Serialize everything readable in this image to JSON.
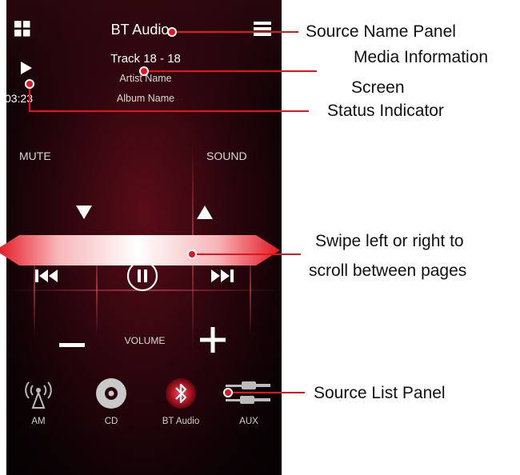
{
  "header": {
    "source_name": "BT Audio"
  },
  "media": {
    "track": "Track 18 - 18",
    "artist": "Artist Name",
    "album": "Album Name",
    "elapsed": "03:23"
  },
  "controls": {
    "mute_label": "MUTE",
    "sound_label": "SOUND",
    "volume_label": "VOLUME"
  },
  "sources": [
    {
      "label": "AM",
      "icon": "antenna-icon"
    },
    {
      "label": "CD",
      "icon": "disc-icon"
    },
    {
      "label": "BT Audio",
      "icon": "bluetooth-icon"
    },
    {
      "label": "AUX",
      "icon": "aux-cable-icon"
    }
  ],
  "callouts": {
    "source_name_panel": "Source Name Panel",
    "media_info_line1": "Media Information",
    "media_info_line2": "Screen",
    "status_indicator": "Status Indicator",
    "swipe_line1": "Swipe left or right to",
    "swipe_line2": "scroll between pages",
    "source_list_panel": "Source List Panel"
  },
  "colors": {
    "accent_red": "#e3141f",
    "background": "#2a050c"
  }
}
